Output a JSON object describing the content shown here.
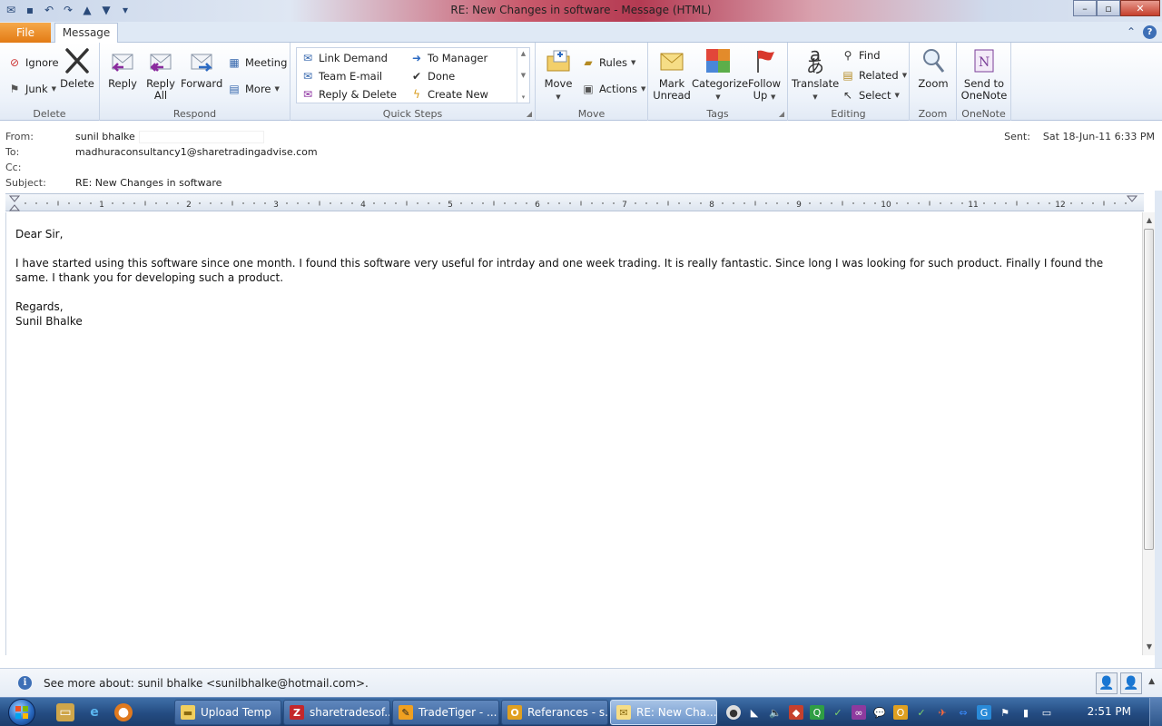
{
  "window": {
    "title": "RE: New Changes in software  -  Message (HTML)"
  },
  "tabs": {
    "file": "File",
    "message": "Message"
  },
  "ribbon": {
    "delete_group": {
      "label": "Delete",
      "ignore": "Ignore",
      "junk": "Junk",
      "delete": "Delete"
    },
    "respond_group": {
      "label": "Respond",
      "reply": "Reply",
      "reply_all_1": "Reply",
      "reply_all_2": "All",
      "forward": "Forward",
      "meeting": "Meeting",
      "more": "More"
    },
    "quick_steps_group": {
      "label": "Quick Steps",
      "items": [
        "Link Demand",
        "Team E-mail",
        "Reply & Delete",
        "To Manager",
        "Done",
        "Create New"
      ]
    },
    "move_group": {
      "label": "Move",
      "move": "Move",
      "rules": "Rules",
      "actions": "Actions"
    },
    "tags_group": {
      "label": "Tags",
      "mark_unread_1": "Mark",
      "mark_unread_2": "Unread",
      "categorize": "Categorize",
      "follow_up_1": "Follow",
      "follow_up_2": "Up"
    },
    "editing_group": {
      "label": "Editing",
      "translate": "Translate",
      "find": "Find",
      "related": "Related",
      "select": "Select"
    },
    "zoom_group": {
      "label": "Zoom",
      "zoom": "Zoom"
    },
    "onenote_group": {
      "label": "OneNote",
      "send_1": "Send to",
      "send_2": "OneNote"
    }
  },
  "header": {
    "from_label": "From:",
    "from_value": "sunil bhalke",
    "to_label": "To:",
    "to_value": "madhuraconsultancy1@sharetradingadvise.com",
    "cc_label": "Cc:",
    "subject_label": "Subject:",
    "subject_value": "RE: New Changes in software",
    "sent_label": "Sent:",
    "sent_value": "Sat 18-Jun-11 6:33 PM"
  },
  "ruler": {
    "numbers": [
      "1",
      "2",
      "3",
      "4",
      "5",
      "6",
      "7",
      "8",
      "9",
      "10",
      "11",
      "12"
    ]
  },
  "body": {
    "greeting": "Dear Sir,",
    "paragraph": "I have started using this software since one month. I found this software very useful for intrday and one week trading. It is really fantastic. Since long I was looking for such product. Finally I found the same. I thank you for developing such a product.",
    "closing": "Regards,",
    "signature": "Sunil Bhalke"
  },
  "people_pane": {
    "text": "See more about: sunil bhalke <sunilbhalke@hotmail.com>."
  },
  "taskbar": {
    "tasks": [
      "Upload Temp",
      "sharetradesof...",
      "TradeTiger - ...",
      "Referances - s...",
      "RE: New Cha..."
    ],
    "clock": "2:51 PM"
  },
  "colors": {
    "file_tab": "#e37b14",
    "taskbar": "#244c82",
    "accent": "#3d6fb6"
  }
}
